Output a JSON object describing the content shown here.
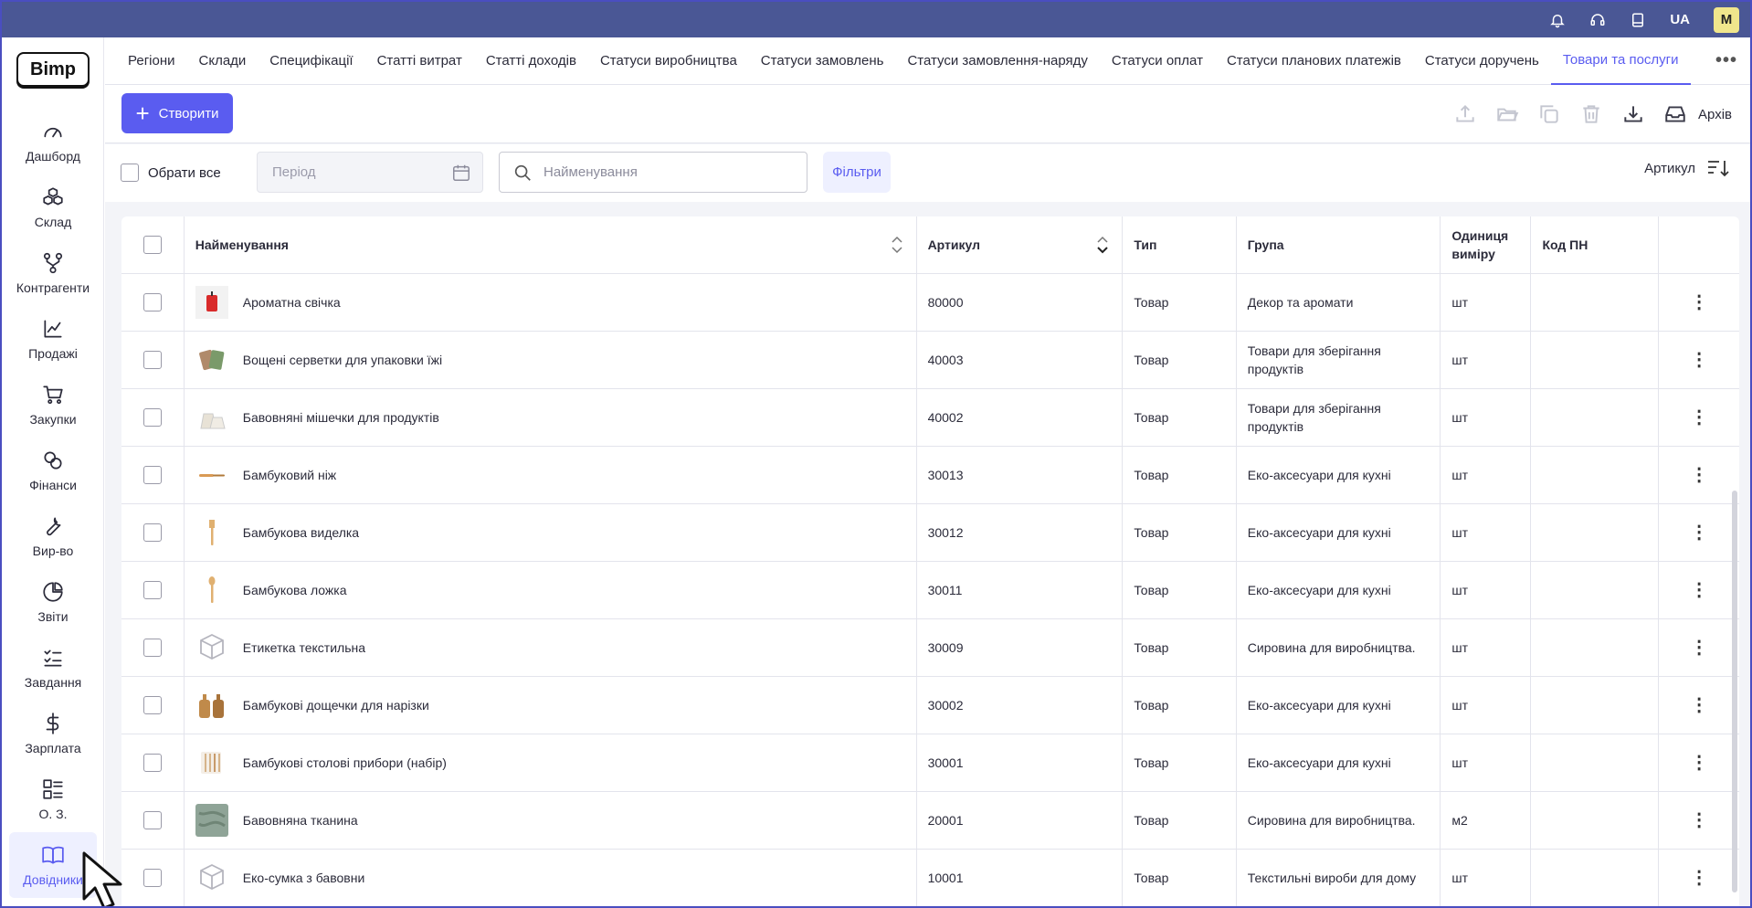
{
  "app": {
    "logo": "Bimp"
  },
  "topbar": {
    "lang": "UA",
    "avatar": "M"
  },
  "sidebar": {
    "items": [
      {
        "label": "Дашборд",
        "icon": "gauge-icon"
      },
      {
        "label": "Склад",
        "icon": "boxes-icon"
      },
      {
        "label": "Контрагенти",
        "icon": "network-icon"
      },
      {
        "label": "Продажі",
        "icon": "chart-line-icon"
      },
      {
        "label": "Закупки",
        "icon": "cart-icon"
      },
      {
        "label": "Фінанси",
        "icon": "coins-icon"
      },
      {
        "label": "Вир-во",
        "icon": "wrench-icon"
      },
      {
        "label": "Звіти",
        "icon": "pie-chart-icon"
      },
      {
        "label": "Завдання",
        "icon": "task-list-icon"
      },
      {
        "label": "Зарплата",
        "icon": "dollar-icon"
      },
      {
        "label": "О. З.",
        "icon": "grid-list-icon"
      },
      {
        "label": "Довідники",
        "icon": "book-icon",
        "active": true
      }
    ]
  },
  "tabs": [
    "Регіони",
    "Склади",
    "Специфікації",
    "Статті витрат",
    "Статті доходів",
    "Статуси виробництва",
    "Статуси замовлень",
    "Статуси замовлення-наряду",
    "Статуси оплат",
    "Статуси планових платежів",
    "Статуси доручень",
    "Товари та послуги"
  ],
  "active_tab": "Товари та послуги",
  "toolbar": {
    "create_label": "Створити",
    "archive_label": "Архів"
  },
  "filters": {
    "select_all_label": "Обрати все",
    "period_placeholder": "Період",
    "search_placeholder": "Найменування",
    "filters_label": "Фільтри",
    "sort_label": "Артикул"
  },
  "table": {
    "headers": {
      "name": "Найменування",
      "sku": "Артикул",
      "type": "Тип",
      "group": "Група",
      "unit": "Одиниця виміру",
      "code": "Код ПН"
    },
    "rows": [
      {
        "name": "Ароматна свічка",
        "sku": "80000",
        "type": "Товар",
        "group": "Декор та аромати",
        "unit": "шт",
        "code": "",
        "thumb": "candle",
        "color": "#d92b2b"
      },
      {
        "name": "Вощені серветки для упаковки їжі",
        "sku": "40003",
        "type": "Товар",
        "group": "Товари для зберігання продуктів",
        "unit": "шт",
        "code": "",
        "thumb": "wraps",
        "color": "#b08a6a"
      },
      {
        "name": "Бавовняні мішечки для продуктів",
        "sku": "40002",
        "type": "Товар",
        "group": "Товари для зберігання продуктів",
        "unit": "шт",
        "code": "",
        "thumb": "bags",
        "color": "#e8e2d6"
      },
      {
        "name": "Бамбуковий ніж",
        "sku": "30013",
        "type": "Товар",
        "group": "Еко-аксесуари для кухні",
        "unit": "шт",
        "code": "",
        "thumb": "knife",
        "color": "#d99a55"
      },
      {
        "name": "Бамбукова виделка",
        "sku": "30012",
        "type": "Товар",
        "group": "Еко-аксесуари для кухні",
        "unit": "шт",
        "code": "",
        "thumb": "fork",
        "color": "#e0b070"
      },
      {
        "name": "Бамбукова ложка",
        "sku": "30011",
        "type": "Товар",
        "group": "Еко-аксесуари для кухні",
        "unit": "шт",
        "code": "",
        "thumb": "spoon",
        "color": "#e0b070"
      },
      {
        "name": "Етикетка текстильна",
        "sku": "30009",
        "type": "Товар",
        "group": "Сировина для виробництва.",
        "unit": "шт",
        "code": "",
        "thumb": "box",
        "color": "#b5b5be"
      },
      {
        "name": "Бамбукові дощечки для нарізки",
        "sku": "30002",
        "type": "Товар",
        "group": "Еко-аксесуари для кухні",
        "unit": "шт",
        "code": "",
        "thumb": "boards",
        "color": "#c08a4a"
      },
      {
        "name": "Бамбукові столові прибори (набір)",
        "sku": "30001",
        "type": "Товар",
        "group": "Еко-аксесуари для кухні",
        "unit": "шт",
        "code": "",
        "thumb": "cutlery",
        "color": "#d6b48a"
      },
      {
        "name": "Бавовняна тканина",
        "sku": "20001",
        "type": "Товар",
        "group": "Сировина для виробництва.",
        "unit": "м2",
        "code": "",
        "thumb": "fabric",
        "color": "#8fa497"
      },
      {
        "name": "Еко-сумка з бавовни",
        "sku": "10001",
        "type": "Товар",
        "group": "Текстильні вироби для дому",
        "unit": "шт",
        "code": "",
        "thumb": "box",
        "color": "#b5b5be"
      }
    ]
  }
}
